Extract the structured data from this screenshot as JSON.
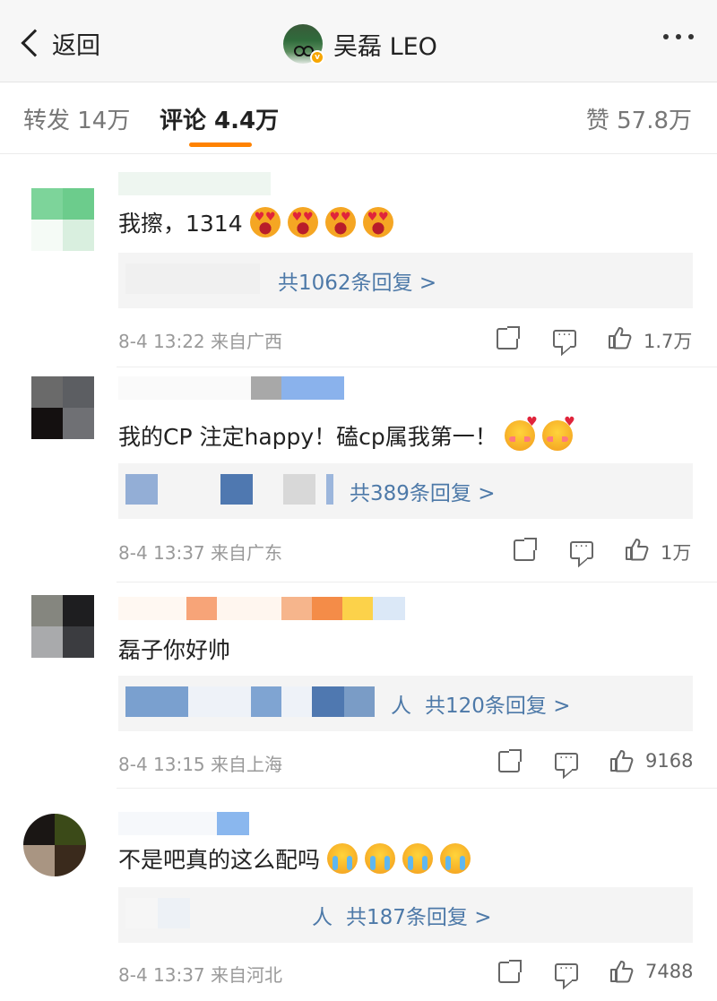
{
  "header": {
    "back_label": "返回",
    "profile_name": "吴磊 LEO",
    "verified_badge": "v"
  },
  "tabs": {
    "repost": "转发 14万",
    "comments": "评论 4.4万",
    "likes": "赞 57.8万"
  },
  "colors": {
    "accent": "#ff8200",
    "link": "#4d79a8",
    "meta": "#999999"
  },
  "comments": [
    {
      "text": "我擦，1314",
      "emojis": [
        "heart-eyes-emoji",
        "heart-eyes-emoji",
        "heart-eyes-emoji",
        "heart-eyes-emoji"
      ],
      "reply_link": "共1062条回复 >",
      "meta": "8-4 13:22  来自广西",
      "likes": "1.7万"
    },
    {
      "text": "我的CP 注定happy！磕cp属我第一！",
      "emojis": [
        "blushing-emoji",
        "blushing-emoji"
      ],
      "reply_link": "共389条回复 >",
      "meta": "8-4 13:37  来自广东",
      "likes": "1万"
    },
    {
      "text": "磊子你好帅",
      "emojis": [],
      "reply_prefix": "人",
      "reply_link": "共120条回复 >",
      "meta": "8-4 13:15  来自上海",
      "likes": "9168"
    },
    {
      "text": "不是吧真的这么配吗",
      "emojis": [
        "crying-emoji",
        "crying-emoji",
        "crying-emoji",
        "crying-emoji"
      ],
      "reply_prefix": "人",
      "reply_link": "共187条回复 >",
      "meta": "8-4 13:37  来自河北",
      "likes": "7488"
    }
  ]
}
